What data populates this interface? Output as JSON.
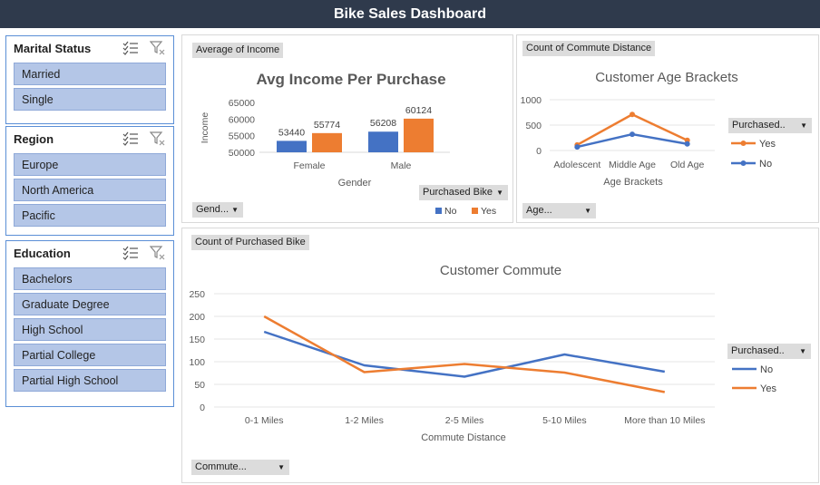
{
  "header": {
    "title": "Bike Sales Dashboard"
  },
  "slicers": [
    {
      "title": "Marital Status",
      "items": [
        "Married",
        "Single"
      ]
    },
    {
      "title": "Region",
      "items": [
        "Europe",
        "North America",
        "Pacific"
      ]
    },
    {
      "title": "Education",
      "items": [
        "Bachelors",
        "Graduate Degree",
        "High School",
        "Partial College",
        "Partial High School"
      ]
    }
  ],
  "income_panel": {
    "field_label": "Average of Income",
    "axis_dropdown": "Gend...",
    "legend_dropdown": "Purchased Bike"
  },
  "age_panel": {
    "field_label": "Count of Commute Distance",
    "axis_dropdown": "Age...",
    "legend_dropdown": "Purchased.."
  },
  "commute_panel": {
    "field_label": "Count of Purchased Bike",
    "axis_dropdown": "Commute...",
    "legend_dropdown": "Purchased.."
  },
  "colors": {
    "no": "#4472c4",
    "yes": "#ed7d31",
    "header": "#2f3a4c",
    "slicer_item": "#b4c6e7"
  },
  "chart_data": [
    {
      "id": "income",
      "type": "bar",
      "title": "Avg Income Per Purchase",
      "xlabel": "Gender",
      "ylabel": "Income",
      "categories": [
        "Female",
        "Male"
      ],
      "series": [
        {
          "name": "No",
          "values": [
            53440,
            56208
          ]
        },
        {
          "name": "Yes",
          "values": [
            55774,
            60124
          ]
        }
      ],
      "yticks": [
        "65000",
        "60000",
        "55000",
        "50000"
      ],
      "ylim": [
        50000,
        65000
      ],
      "legend": "bottom"
    },
    {
      "id": "age",
      "type": "line",
      "title": "Customer Age Brackets",
      "xlabel": "Age Brackets",
      "categories": [
        "Adolescent",
        "Middle Age",
        "Old Age"
      ],
      "series": [
        {
          "name": "Yes",
          "values": [
            110,
            710,
            200
          ]
        },
        {
          "name": "No",
          "values": [
            70,
            320,
            130
          ]
        }
      ],
      "yticks": [
        "1000",
        "500",
        "0"
      ],
      "ylim": [
        0,
        1000
      ],
      "legend": "right"
    },
    {
      "id": "commute",
      "type": "line",
      "title": "Customer Commute",
      "xlabel": "Commute Distance",
      "categories": [
        "0-1 Miles",
        "1-2 Miles",
        "2-5 Miles",
        "5-10 Miles",
        "More than 10 Miles"
      ],
      "series": [
        {
          "name": "No",
          "values": [
            166,
            92,
            67,
            116,
            78
          ]
        },
        {
          "name": "Yes",
          "values": [
            200,
            77,
            95,
            76,
            33
          ]
        }
      ],
      "yticks": [
        "250",
        "200",
        "150",
        "100",
        "50",
        "0"
      ],
      "ylim": [
        0,
        250
      ],
      "legend": "right"
    }
  ]
}
